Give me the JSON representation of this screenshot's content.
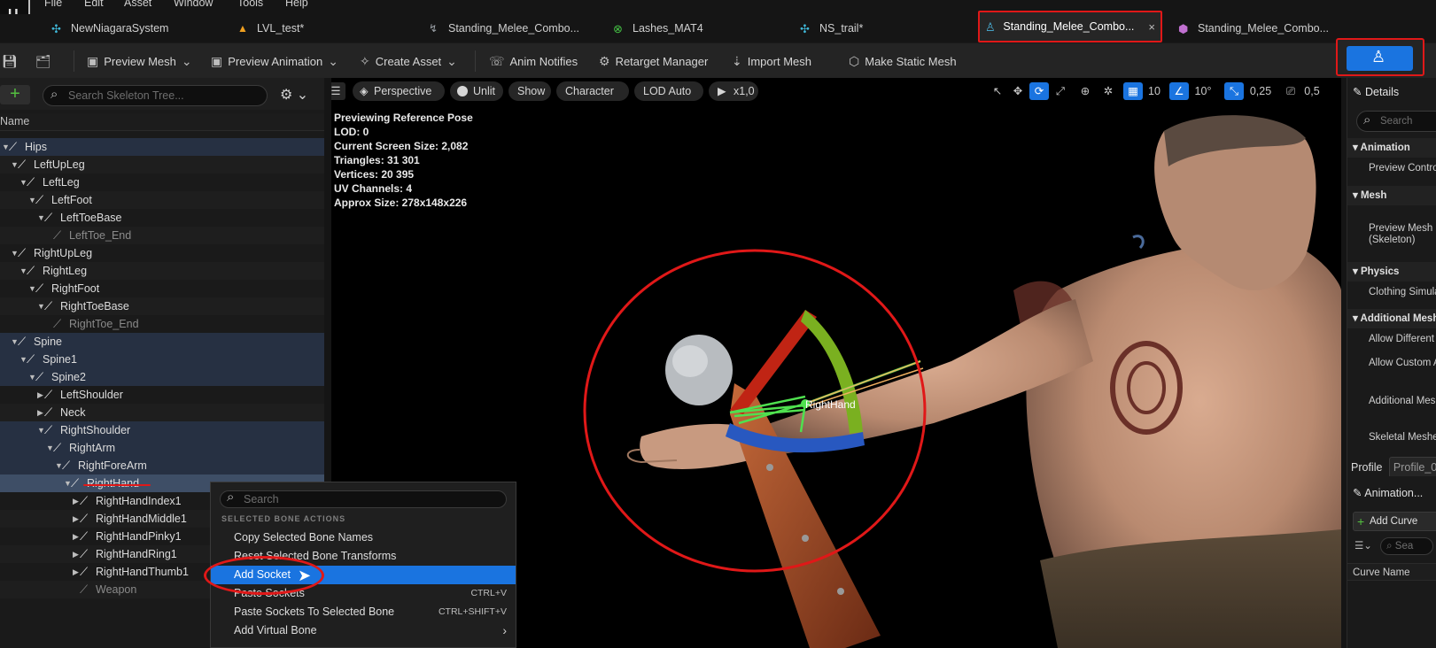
{
  "menu": [
    "File",
    "Edit",
    "Asset",
    "Window",
    "Tools",
    "Help"
  ],
  "tabs": [
    {
      "label": "NewNiagaraSystem",
      "icon": "niagara-system-icon",
      "color": "#3fb6d6"
    },
    {
      "label": "LVL_test*",
      "icon": "level-icon",
      "color": "#f0a020"
    },
    {
      "label": "Standing_Melee_Combo...",
      "icon": "animation-icon",
      "color": "#9aa0a6"
    },
    {
      "label": "Lashes_MAT4",
      "icon": "material-icon",
      "color": "#45c145"
    },
    {
      "label": "NS_trail*",
      "icon": "niagara-system-icon",
      "color": "#3fb6d6"
    },
    {
      "label": "Standing_Melee_Combo...",
      "icon": "skeleton-icon",
      "color": "#4ab0d8",
      "close": "×"
    },
    {
      "label": "Standing_Melee_Combo...",
      "icon": "physics-asset-icon",
      "color": "#c070d0"
    }
  ],
  "toolbar": {
    "preview_mesh": "Preview Mesh",
    "preview_animation": "Preview Animation",
    "create_asset": "Create Asset",
    "anim_notifies": "Anim Notifies",
    "retarget_manager": "Retarget Manager",
    "import_mesh": "Import Mesh",
    "make_static_mesh": "Make Static Mesh"
  },
  "skeleton_tree": {
    "search_placeholder": "Search Skeleton Tree...",
    "column_name": "Name",
    "bones": [
      {
        "name": "Hips",
        "depth": 0
      },
      {
        "name": "LeftUpLeg",
        "depth": 1
      },
      {
        "name": "LeftLeg",
        "depth": 2
      },
      {
        "name": "LeftFoot",
        "depth": 3
      },
      {
        "name": "LeftToeBase",
        "depth": 4
      },
      {
        "name": "LeftToe_End",
        "depth": 5
      },
      {
        "name": "RightUpLeg",
        "depth": 1
      },
      {
        "name": "RightLeg",
        "depth": 2
      },
      {
        "name": "RightFoot",
        "depth": 3
      },
      {
        "name": "RightToeBase",
        "depth": 4
      },
      {
        "name": "RightToe_End",
        "depth": 5
      },
      {
        "name": "Spine",
        "depth": 1
      },
      {
        "name": "Spine1",
        "depth": 2
      },
      {
        "name": "Spine2",
        "depth": 3
      },
      {
        "name": "LeftShoulder",
        "depth": 4
      },
      {
        "name": "Neck",
        "depth": 4
      },
      {
        "name": "RightShoulder",
        "depth": 4
      },
      {
        "name": "RightArm",
        "depth": 5
      },
      {
        "name": "RightForeArm",
        "depth": 6
      },
      {
        "name": "RightHand",
        "depth": 7
      },
      {
        "name": "RightHandIndex1",
        "depth": 8
      },
      {
        "name": "RightHandMiddle1",
        "depth": 8
      },
      {
        "name": "RightHandPinky1",
        "depth": 8
      },
      {
        "name": "RightHandRing1",
        "depth": 8
      },
      {
        "name": "RightHandThumb1",
        "depth": 8
      },
      {
        "name": "Weapon",
        "depth": 8
      }
    ]
  },
  "viewport": {
    "perspective": "Perspective",
    "unlit": "Unlit",
    "show": "Show",
    "character": "Character",
    "lod": "LOD Auto",
    "speed": "x1,0",
    "grid_snap": "10",
    "rot_snap": "10°",
    "scale_snap": "0,25",
    "camera_speed": "0,5",
    "bone_label": "RightHand",
    "stats": [
      "Previewing Reference Pose",
      "LOD: 0",
      "Current Screen Size: 2,082",
      "Triangles: 31 301",
      "Vertices: 20 395",
      "UV Channels: 4",
      "Approx Size: 278x148x226"
    ]
  },
  "context_menu": {
    "search_placeholder": "Search",
    "section": "SELECTED BONE ACTIONS",
    "items": [
      {
        "label": "Copy Selected Bone Names",
        "shortcut": ""
      },
      {
        "label": "Reset Selected Bone Transforms",
        "shortcut": ""
      },
      {
        "label": "Add Socket",
        "shortcut": ""
      },
      {
        "label": "Paste Sockets",
        "shortcut": "CTRL+V"
      },
      {
        "label": "Paste Sockets To Selected Bone",
        "shortcut": "CTRL+SHIFT+V"
      },
      {
        "label": "Add Virtual Bone",
        "shortcut": ""
      }
    ],
    "submenu_arrow": "›"
  },
  "details": {
    "title": "Details",
    "search_placeholder": "Search",
    "sections": [
      "Animation",
      "Mesh",
      "Physics",
      "Additional Mesh"
    ],
    "preview_controller": "Preview Controll",
    "preview_mesh": "Preview Mesh",
    "preview_mesh_sub": "(Skeleton)",
    "clothing": "Clothing Simula",
    "allow_different": "Allow Different",
    "allow_custom": "Allow Custom A",
    "additional_mesh": "Additional Mesh",
    "skeletal_meshes": "Skeletal Meshe",
    "profile_label": "Profile",
    "profile_value": "Profile_0",
    "animation_tab": "Animation...",
    "add_curve": "Add Curve",
    "curve_search": "Sea",
    "curve_name": "Curve Name"
  },
  "colors": {
    "accent": "#1a74e0",
    "highlight_red": "#e01818",
    "add_green": "#54c040"
  }
}
